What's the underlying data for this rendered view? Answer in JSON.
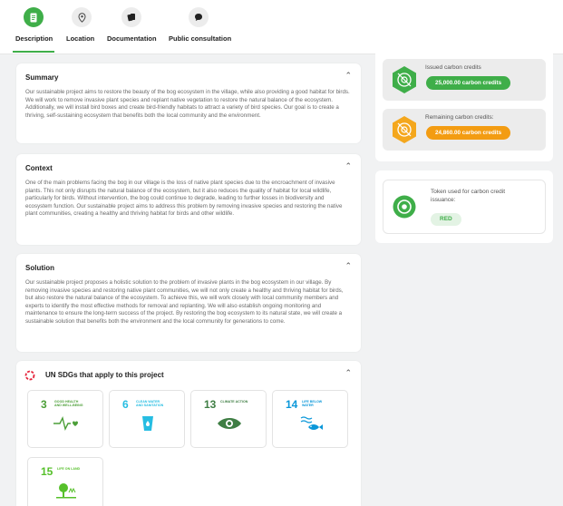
{
  "tabs": [
    {
      "label": "Description",
      "active": true
    },
    {
      "label": "Location"
    },
    {
      "label": "Documentation"
    },
    {
      "label": "Public consultation"
    }
  ],
  "summary": {
    "title": "Summary",
    "text": "Our sustainable project aims to restore the beauty of the bog ecosystem in the village, while also providing a good habitat for birds. We will work to remove invasive plant species and replant native vegetation to restore the natural balance of the ecosystem. Additionally, we will install bird boxes and create bird-friendly habitats to attract a variety of bird species. Our goal is to create a thriving, self-sustaining ecosystem that benefits both the local community and the environment."
  },
  "context": {
    "title": "Context",
    "text": "One of the main problems facing the bog in our village is the loss of native plant species due to the encroachment of invasive plants. This not only disrupts the natural balance of the ecosystem, but it also reduces the quality of habitat for local wildlife, particularly for birds. Without intervention, the bog could continue to degrade, leading to further losses in biodiversity and ecosystem function. Our sustainable project aims to address this problem by removing invasive species and restoring the native plant communities, creating a healthy and thriving habitat for birds and other wildlife."
  },
  "solution": {
    "title": "Solution",
    "text": "Our sustainable project proposes a holistic solution to the problem of invasive plants in the bog ecosystem in our village. By removing invasive species and restoring native plant communities, we will not only create a healthy and thriving habitat for birds, but also restore the natural balance of the ecosystem. To achieve this, we will work closely with local community members and experts to identify the most effective methods for removal and replanting. We will also establish ongoing monitoring and maintenance to ensure the long-term success of the project. By restoring the bog ecosystem to its natural state, we will create a sustainable solution that benefits both the environment and the local community for generations to come."
  },
  "sdgs": {
    "title": "UN SDGs that apply to this project",
    "items": [
      {
        "num": "3",
        "title": "GOOD HEALTH AND WELL-BEING",
        "color": "#4c9f38",
        "icon": "heartbeat-icon"
      },
      {
        "num": "6",
        "title": "CLEAN WATER AND SANITATION",
        "color": "#26bde2",
        "icon": "water-glass-icon"
      },
      {
        "num": "13",
        "title": "CLIMATE ACTION",
        "color": "#3f7e44",
        "icon": "eye-globe-icon"
      },
      {
        "num": "14",
        "title": "LIFE BELOW WATER",
        "color": "#0a97d9",
        "icon": "fish-icon"
      },
      {
        "num": "15",
        "title": "LIFE ON LAND",
        "color": "#56c02b",
        "icon": "tree-icon"
      }
    ]
  },
  "credits": {
    "issued_label": "Issued carbon credits",
    "issued_value": "25,000.00 carbon credits",
    "issued_color": "#3fae49",
    "remaining_label": "Remaining carbon credits:",
    "remaining_value": "24,860.00 carbon credits",
    "remaining_color": "#f39c12"
  },
  "token": {
    "label": "Token used for carbon credit issuance:",
    "value": "RED"
  }
}
